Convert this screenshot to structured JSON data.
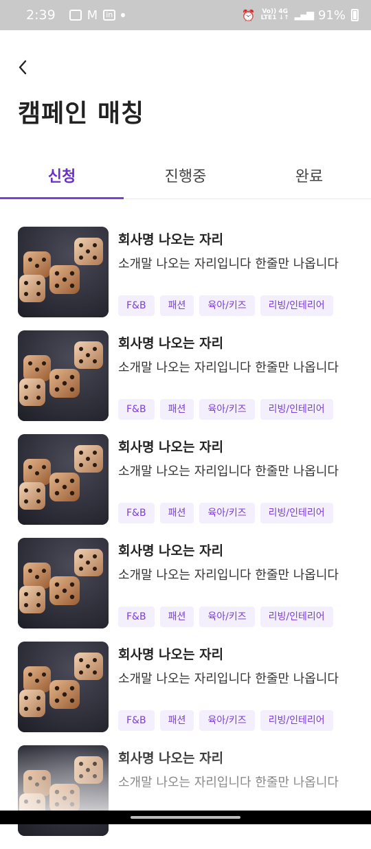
{
  "status_bar": {
    "time": "2:39",
    "network_top": "Vo)) 4G",
    "network_bottom": "LTE1 ↓↑",
    "battery": "91%"
  },
  "header": {
    "back_icon": "chevron-left-icon",
    "title": "캠페인 매칭"
  },
  "tabs": [
    {
      "label": "신청",
      "active": true
    },
    {
      "label": "진행중",
      "active": false
    },
    {
      "label": "완료",
      "active": false
    }
  ],
  "campaigns": [
    {
      "company": "회사명 나오는 자리",
      "intro": "소개말 나오는 자리입니다 한줄만 나옵니다",
      "tags": [
        "F&B",
        "패션",
        "육아/키즈",
        "리빙/인테리어"
      ]
    },
    {
      "company": "회사명 나오는 자리",
      "intro": "소개말 나오는 자리입니다 한줄만 나옵니다",
      "tags": [
        "F&B",
        "패션",
        "육아/키즈",
        "리빙/인테리어"
      ]
    },
    {
      "company": "회사명 나오는 자리",
      "intro": "소개말 나오는 자리입니다 한줄만 나옵니다",
      "tags": [
        "F&B",
        "패션",
        "육아/키즈",
        "리빙/인테리어"
      ]
    },
    {
      "company": "회사명 나오는 자리",
      "intro": "소개말 나오는 자리입니다 한줄만 나옵니다",
      "tags": [
        "F&B",
        "패션",
        "육아/키즈",
        "리빙/인테리어"
      ]
    },
    {
      "company": "회사명 나오는 자리",
      "intro": "소개말 나오는 자리입니다 한줄만 나옵니다",
      "tags": [
        "F&B",
        "패션",
        "육아/키즈",
        "리빙/인테리어"
      ]
    },
    {
      "company": "회사명 나오는 자리",
      "intro": "소개말 나오는 자리입니다 한줄만 나옵니다",
      "tags": []
    }
  ],
  "colors": {
    "accent": "#7b3fd6",
    "tag_bg": "#f4effd"
  }
}
